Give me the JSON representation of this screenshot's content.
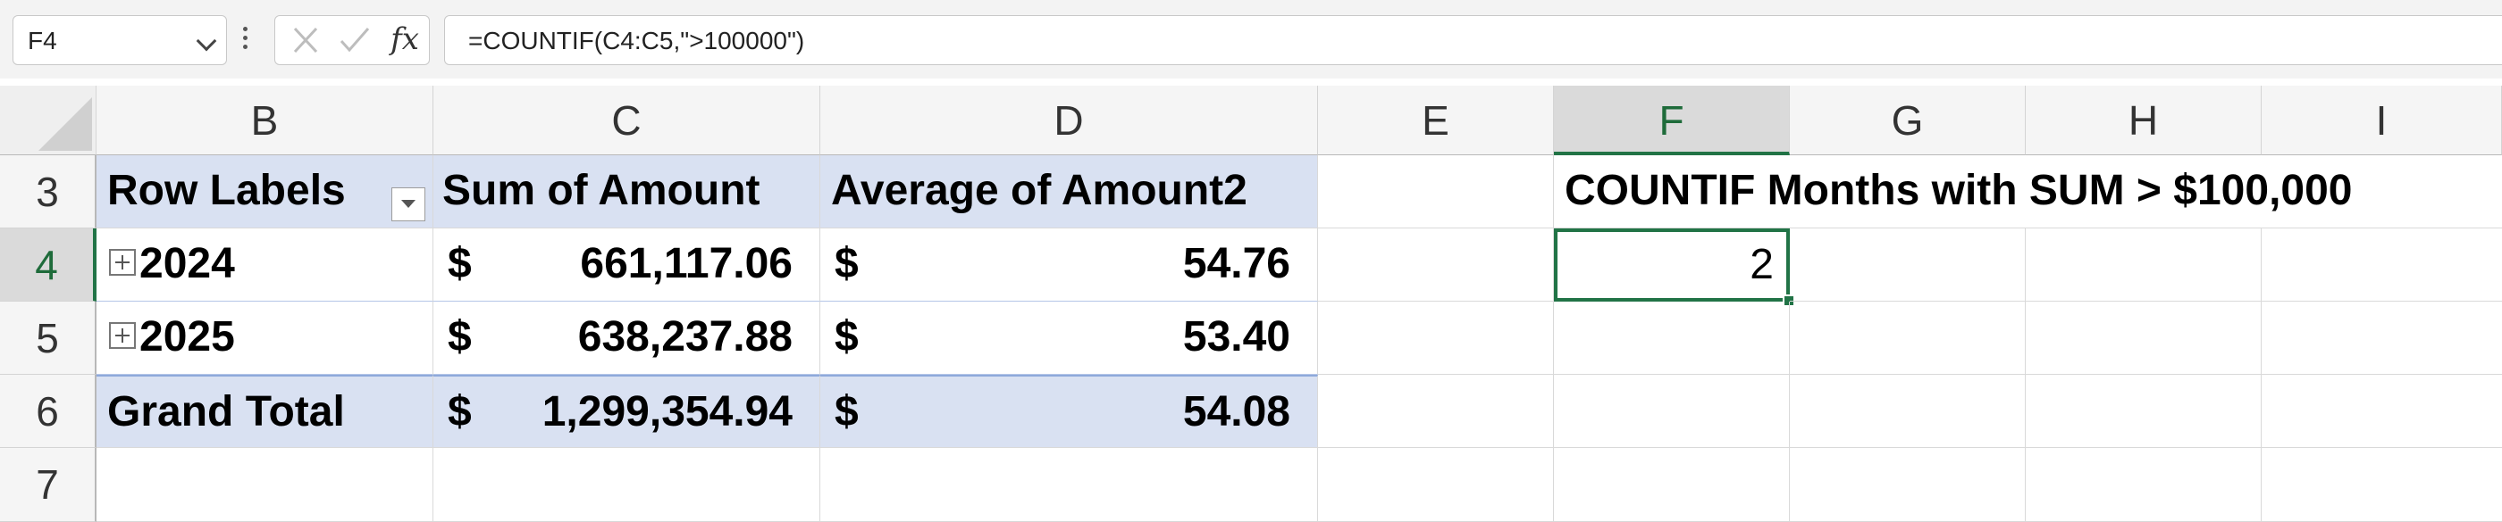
{
  "formula_bar": {
    "name_box": "F4",
    "fx_label": "fx",
    "formula": "=COUNTIF(C4:C5,\">100000\")"
  },
  "columns": [
    "B",
    "C",
    "D",
    "E",
    "F",
    "G",
    "H",
    "I"
  ],
  "rows": [
    "3",
    "4",
    "5",
    "6",
    "7"
  ],
  "pivot": {
    "header": {
      "row_labels": "Row Labels",
      "sum_amount": "Sum of Amount",
      "avg_amount": "Average of Amount2"
    },
    "rows": [
      {
        "label": "2024",
        "sum_currency": "$",
        "sum_value": "661,117.06",
        "avg_currency": "$",
        "avg_value": "54.76"
      },
      {
        "label": "2025",
        "sum_currency": "$",
        "sum_value": "638,237.88",
        "avg_currency": "$",
        "avg_value": "53.40"
      }
    ],
    "total": {
      "label": "Grand Total",
      "sum_currency": "$",
      "sum_value": "1,299,354.94",
      "avg_currency": "$",
      "avg_value": "54.08"
    }
  },
  "countif": {
    "label": "COUNTIF Months with SUM > $100,000",
    "result": "2"
  },
  "active_cell": "F4",
  "colors": {
    "accent": "#217346",
    "pivot_header": "#d9e1f2"
  }
}
